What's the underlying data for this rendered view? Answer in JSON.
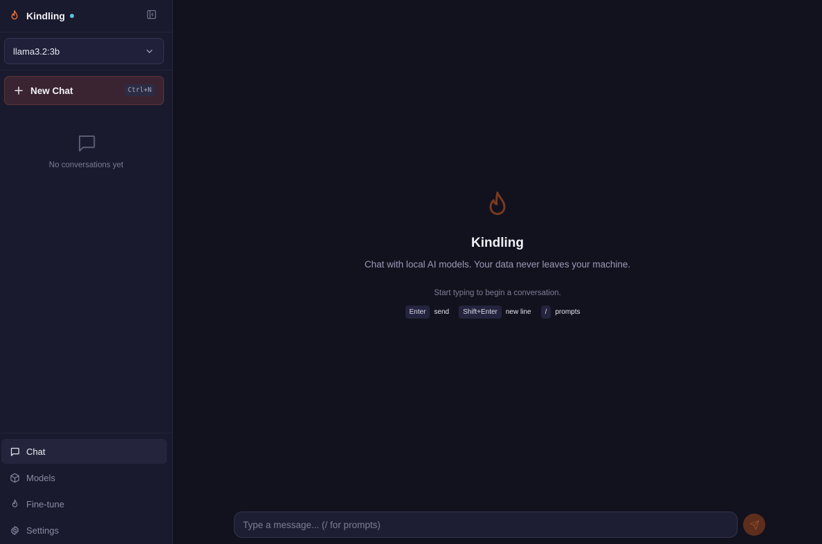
{
  "app": {
    "name": "Kindling",
    "status_color": "#5ec4dc",
    "accent_color": "#e8692e"
  },
  "sidebar": {
    "model_selector": {
      "selected": "llama3.2:3b"
    },
    "new_chat": {
      "label": "New Chat",
      "shortcut": "Ctrl+N"
    },
    "conversations": {
      "empty_text": "No conversations yet"
    },
    "nav": [
      {
        "label": "Chat",
        "icon": "message-square-icon",
        "active": true
      },
      {
        "label": "Models",
        "icon": "cube-icon",
        "active": false
      },
      {
        "label": "Fine-tune",
        "icon": "flame-icon",
        "active": false
      },
      {
        "label": "Settings",
        "icon": "gear-icon",
        "active": false
      }
    ]
  },
  "welcome": {
    "title": "Kindling",
    "subtitle": "Chat with local AI models. Your data never leaves your machine.",
    "hint": "Start typing to begin a conversation.",
    "shortcuts": [
      {
        "key": "Enter",
        "label": "send"
      },
      {
        "key": "Shift+Enter",
        "label": "new line"
      },
      {
        "key": "/",
        "label": "prompts"
      }
    ]
  },
  "composer": {
    "value": "",
    "placeholder": "Type a message... (/ for prompts)"
  }
}
